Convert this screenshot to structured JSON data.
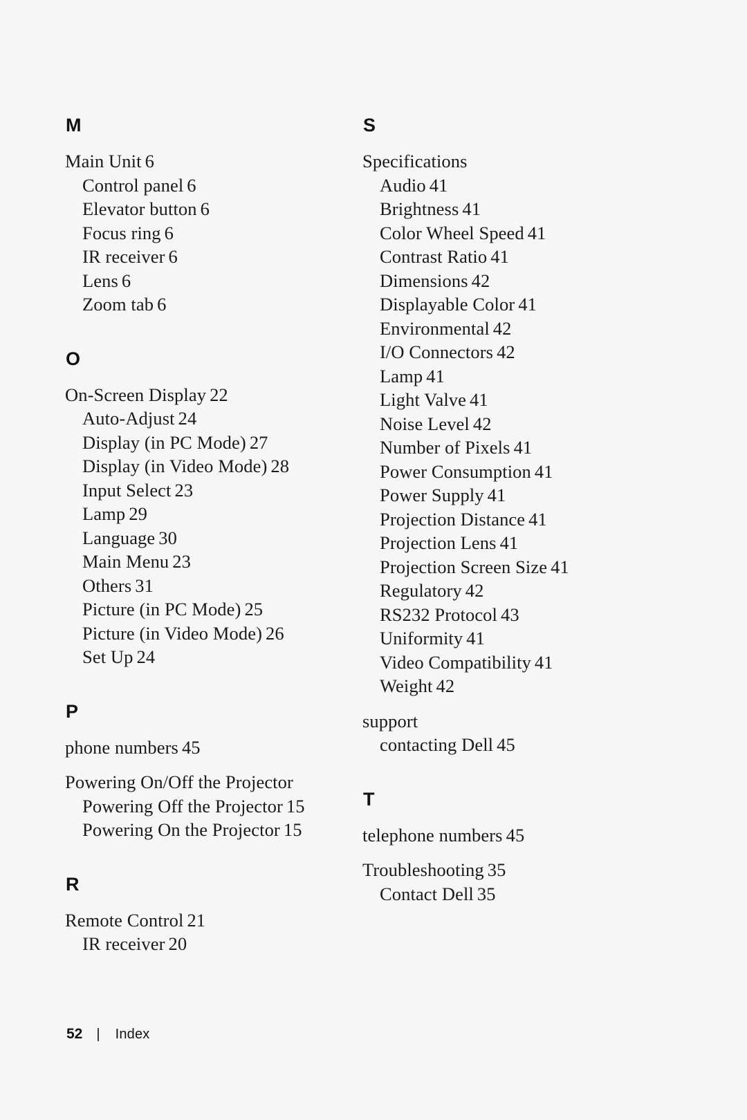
{
  "document": {
    "footer": {
      "page_number": "52",
      "separator": "|",
      "section_label": "Index"
    }
  },
  "columns": [
    {
      "name": "left-column",
      "sections": [
        {
          "letter": "M",
          "groups": [
            {
              "entries": [
                {
                  "label": "Main Unit",
                  "page": "6",
                  "level": 1
                },
                {
                  "label": "Control panel",
                  "page": "6",
                  "level": 2
                },
                {
                  "label": "Elevator button",
                  "page": "6",
                  "level": 2
                },
                {
                  "label": "Focus ring",
                  "page": "6",
                  "level": 2
                },
                {
                  "label": "IR receiver",
                  "page": "6",
                  "level": 2
                },
                {
                  "label": "Lens",
                  "page": "6",
                  "level": 2
                },
                {
                  "label": "Zoom tab",
                  "page": "6",
                  "level": 2
                }
              ]
            }
          ]
        },
        {
          "letter": "O",
          "groups": [
            {
              "entries": [
                {
                  "label": "On-Screen Display",
                  "page": "22",
                  "level": 1
                },
                {
                  "label": "Auto-Adjust",
                  "page": "24",
                  "level": 2
                },
                {
                  "label": "Display (in PC Mode)",
                  "page": "27",
                  "level": 2
                },
                {
                  "label": "Display (in Video Mode)",
                  "page": "28",
                  "level": 2
                },
                {
                  "label": "Input Select",
                  "page": "23",
                  "level": 2
                },
                {
                  "label": "Lamp",
                  "page": "29",
                  "level": 2
                },
                {
                  "label": "Language",
                  "page": "30",
                  "level": 2
                },
                {
                  "label": "Main Menu",
                  "page": "23",
                  "level": 2
                },
                {
                  "label": "Others",
                  "page": "31",
                  "level": 2
                },
                {
                  "label": "Picture (in PC Mode)",
                  "page": "25",
                  "level": 2
                },
                {
                  "label": "Picture (in Video Mode)",
                  "page": "26",
                  "level": 2
                },
                {
                  "label": "Set Up",
                  "page": "24",
                  "level": 2
                }
              ]
            }
          ]
        },
        {
          "letter": "P",
          "groups": [
            {
              "entries": [
                {
                  "label": "phone numbers",
                  "page": "45",
                  "level": 1
                }
              ]
            },
            {
              "entries": [
                {
                  "label": "Powering On/Off the Projector",
                  "page": "",
                  "level": 1
                },
                {
                  "label": "Powering Off the Projector",
                  "page": "15",
                  "level": 2
                },
                {
                  "label": "Powering On the Projector",
                  "page": "15",
                  "level": 2
                }
              ]
            }
          ]
        },
        {
          "letter": "R",
          "groups": [
            {
              "entries": [
                {
                  "label": "Remote Control",
                  "page": "21",
                  "level": 1
                },
                {
                  "label": "IR receiver",
                  "page": "20",
                  "level": 2
                }
              ]
            }
          ]
        }
      ]
    },
    {
      "name": "right-column",
      "sections": [
        {
          "letter": "S",
          "groups": [
            {
              "entries": [
                {
                  "label": "Specifications",
                  "page": "",
                  "level": 1
                },
                {
                  "label": "Audio",
                  "page": "41",
                  "level": 2
                },
                {
                  "label": "Brightness",
                  "page": "41",
                  "level": 2
                },
                {
                  "label": "Color Wheel Speed",
                  "page": "41",
                  "level": 2
                },
                {
                  "label": "Contrast Ratio",
                  "page": "41",
                  "level": 2
                },
                {
                  "label": "Dimensions",
                  "page": "42",
                  "level": 2
                },
                {
                  "label": "Displayable Color",
                  "page": "41",
                  "level": 2
                },
                {
                  "label": "Environmental",
                  "page": "42",
                  "level": 2
                },
                {
                  "label": "I/O Connectors",
                  "page": "42",
                  "level": 2
                },
                {
                  "label": "Lamp",
                  "page": "41",
                  "level": 2
                },
                {
                  "label": "Light Valve",
                  "page": "41",
                  "level": 2
                },
                {
                  "label": "Noise Level",
                  "page": "42",
                  "level": 2
                },
                {
                  "label": "Number of Pixels",
                  "page": "41",
                  "level": 2
                },
                {
                  "label": "Power Consumption",
                  "page": "41",
                  "level": 2
                },
                {
                  "label": "Power Supply",
                  "page": "41",
                  "level": 2
                },
                {
                  "label": "Projection Distance",
                  "page": "41",
                  "level": 2
                },
                {
                  "label": "Projection Lens",
                  "page": "41",
                  "level": 2
                },
                {
                  "label": "Projection Screen Size",
                  "page": "41",
                  "level": 2
                },
                {
                  "label": "Regulatory",
                  "page": "42",
                  "level": 2
                },
                {
                  "label": "RS232 Protocol",
                  "page": "43",
                  "level": 2
                },
                {
                  "label": "Uniformity",
                  "page": "41",
                  "level": 2
                },
                {
                  "label": "Video Compatibility",
                  "page": "41",
                  "level": 2
                },
                {
                  "label": "Weight",
                  "page": "42",
                  "level": 2
                }
              ]
            },
            {
              "entries": [
                {
                  "label": "support",
                  "page": "",
                  "level": 1
                },
                {
                  "label": "contacting Dell",
                  "page": "45",
                  "level": 2
                }
              ]
            }
          ]
        },
        {
          "letter": "T",
          "groups": [
            {
              "entries": [
                {
                  "label": "telephone numbers",
                  "page": "45",
                  "level": 1
                }
              ]
            },
            {
              "entries": [
                {
                  "label": "Troubleshooting",
                  "page": "35",
                  "level": 1
                },
                {
                  "label": "Contact Dell",
                  "page": "35",
                  "level": 2
                }
              ]
            }
          ]
        }
      ]
    }
  ]
}
